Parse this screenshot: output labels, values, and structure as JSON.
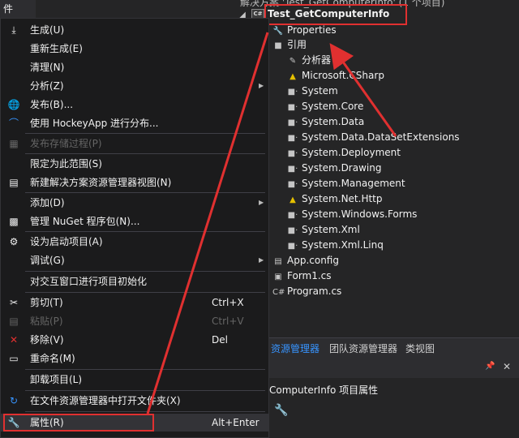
{
  "tree": {
    "solution_label": "解决方案 'Test_GetComputerInfo' (1 个项目)",
    "project": "Test_GetComputerInfo",
    "items": [
      {
        "label": "Properties",
        "icon": "wrench-icon"
      },
      {
        "label": "引用",
        "icon": "references-icon"
      },
      {
        "label": "分析器",
        "icon": "analyzer-icon"
      },
      {
        "label": "Microsoft.CSharp",
        "icon": "warning-icon"
      },
      {
        "label": "System",
        "icon": "reference-icon"
      },
      {
        "label": "System.Core",
        "icon": "reference-icon"
      },
      {
        "label": "System.Data",
        "icon": "reference-icon"
      },
      {
        "label": "System.Data.DataSetExtensions",
        "icon": "reference-icon"
      },
      {
        "label": "System.Deployment",
        "icon": "reference-icon"
      },
      {
        "label": "System.Drawing",
        "icon": "reference-icon"
      },
      {
        "label": "System.Management",
        "icon": "reference-icon"
      },
      {
        "label": "System.Net.Http",
        "icon": "warning-icon"
      },
      {
        "label": "System.Windows.Forms",
        "icon": "reference-icon"
      },
      {
        "label": "System.Xml",
        "icon": "reference-icon"
      },
      {
        "label": "System.Xml.Linq",
        "icon": "reference-icon"
      },
      {
        "label": "App.config",
        "icon": "config-icon"
      },
      {
        "label": "Form1.cs",
        "icon": "form-icon"
      },
      {
        "label": "Program.cs",
        "icon": "csharp-file-icon"
      }
    ]
  },
  "tabs": [
    "资源管理器",
    "团队资源管理器",
    "类视图"
  ],
  "props": {
    "title": "ComputerInfo  项目属性"
  },
  "menu": {
    "title": "件",
    "items": [
      {
        "label": "生成(U)",
        "shortcut": "",
        "icon": "build-icon",
        "disabled": false
      },
      {
        "label": "重新生成(E)",
        "shortcut": "",
        "icon": "",
        "disabled": false
      },
      {
        "label": "清理(N)",
        "shortcut": "",
        "icon": "",
        "disabled": false
      },
      {
        "label": "分析(Z)",
        "shortcut": "",
        "icon": "",
        "disabled": false,
        "submenu": true
      },
      {
        "label": "发布(B)...",
        "shortcut": "",
        "icon": "globe-icon",
        "disabled": false
      },
      {
        "label": "使用 HockeyApp 进行分布...",
        "shortcut": "",
        "icon": "hockeyapp-icon",
        "disabled": false
      },
      {
        "label": "发布存储过程(P)",
        "shortcut": "",
        "icon": "publish-icon",
        "disabled": true
      },
      {
        "label": "限定为此范围(S)",
        "shortcut": "",
        "icon": "",
        "disabled": false
      },
      {
        "label": "新建解决方案资源管理器视图(N)",
        "shortcut": "",
        "icon": "new-view-icon",
        "disabled": false
      },
      {
        "label": "添加(D)",
        "shortcut": "",
        "icon": "",
        "disabled": false,
        "submenu": true
      },
      {
        "label": "管理 NuGet 程序包(N)...",
        "shortcut": "",
        "icon": "nuget-icon",
        "disabled": false
      },
      {
        "label": "设为启动项目(A)",
        "shortcut": "",
        "icon": "gear-icon",
        "disabled": false
      },
      {
        "label": "调试(G)",
        "shortcut": "",
        "icon": "",
        "disabled": false,
        "submenu": true
      },
      {
        "label": "对交互窗口进行项目初始化",
        "shortcut": "",
        "icon": "",
        "disabled": false
      },
      {
        "label": "剪切(T)",
        "shortcut": "Ctrl+X",
        "icon": "scissors-icon",
        "disabled": false
      },
      {
        "label": "粘贴(P)",
        "shortcut": "Ctrl+V",
        "icon": "paste-icon",
        "disabled": true
      },
      {
        "label": "移除(V)",
        "shortcut": "Del",
        "icon": "close-icon",
        "disabled": false
      },
      {
        "label": "重命名(M)",
        "shortcut": "",
        "icon": "rename-icon",
        "disabled": false
      },
      {
        "label": "卸载项目(L)",
        "shortcut": "",
        "icon": "",
        "disabled": false
      },
      {
        "label": "在文件资源管理器中打开文件夹(X)",
        "shortcut": "",
        "icon": "refresh-icon",
        "disabled": false
      },
      {
        "label": "属性(R)",
        "shortcut": "Alt+Enter",
        "icon": "wrench-icon",
        "disabled": false
      }
    ]
  }
}
